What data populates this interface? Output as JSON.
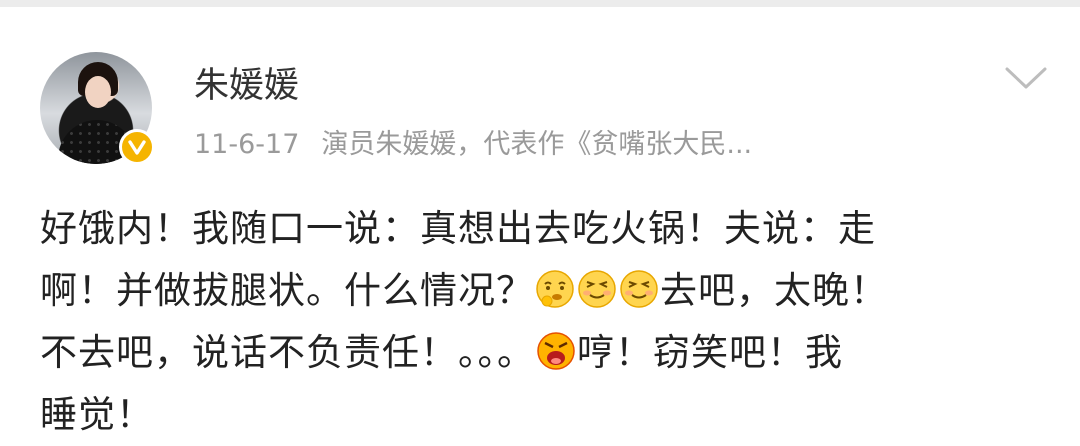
{
  "status_bar": {},
  "post": {
    "author": {
      "name": "朱媛媛",
      "verified_badge": "v-verified-icon",
      "badge_color": "#f5b400"
    },
    "meta": {
      "time": "11-6-17",
      "source": "演员朱媛媛，代表作《贫嘴张大民..."
    },
    "content": {
      "line1": "好饿内！我随口一说：真想出去吃火锅！夫说：走",
      "line2_a": "啊！并做拔腿状。什么情况？",
      "line2_b": "去吧，太晚！",
      "line3_a": "不去吧，说话不负责任！。。。",
      "line3_b": "哼！窃笑吧！我",
      "line4": "睡觉！"
    },
    "emojis": [
      "thinking-emoji-icon",
      "snicker-emoji-icon",
      "snicker-emoji-icon",
      "angry-emoji-icon"
    ]
  }
}
